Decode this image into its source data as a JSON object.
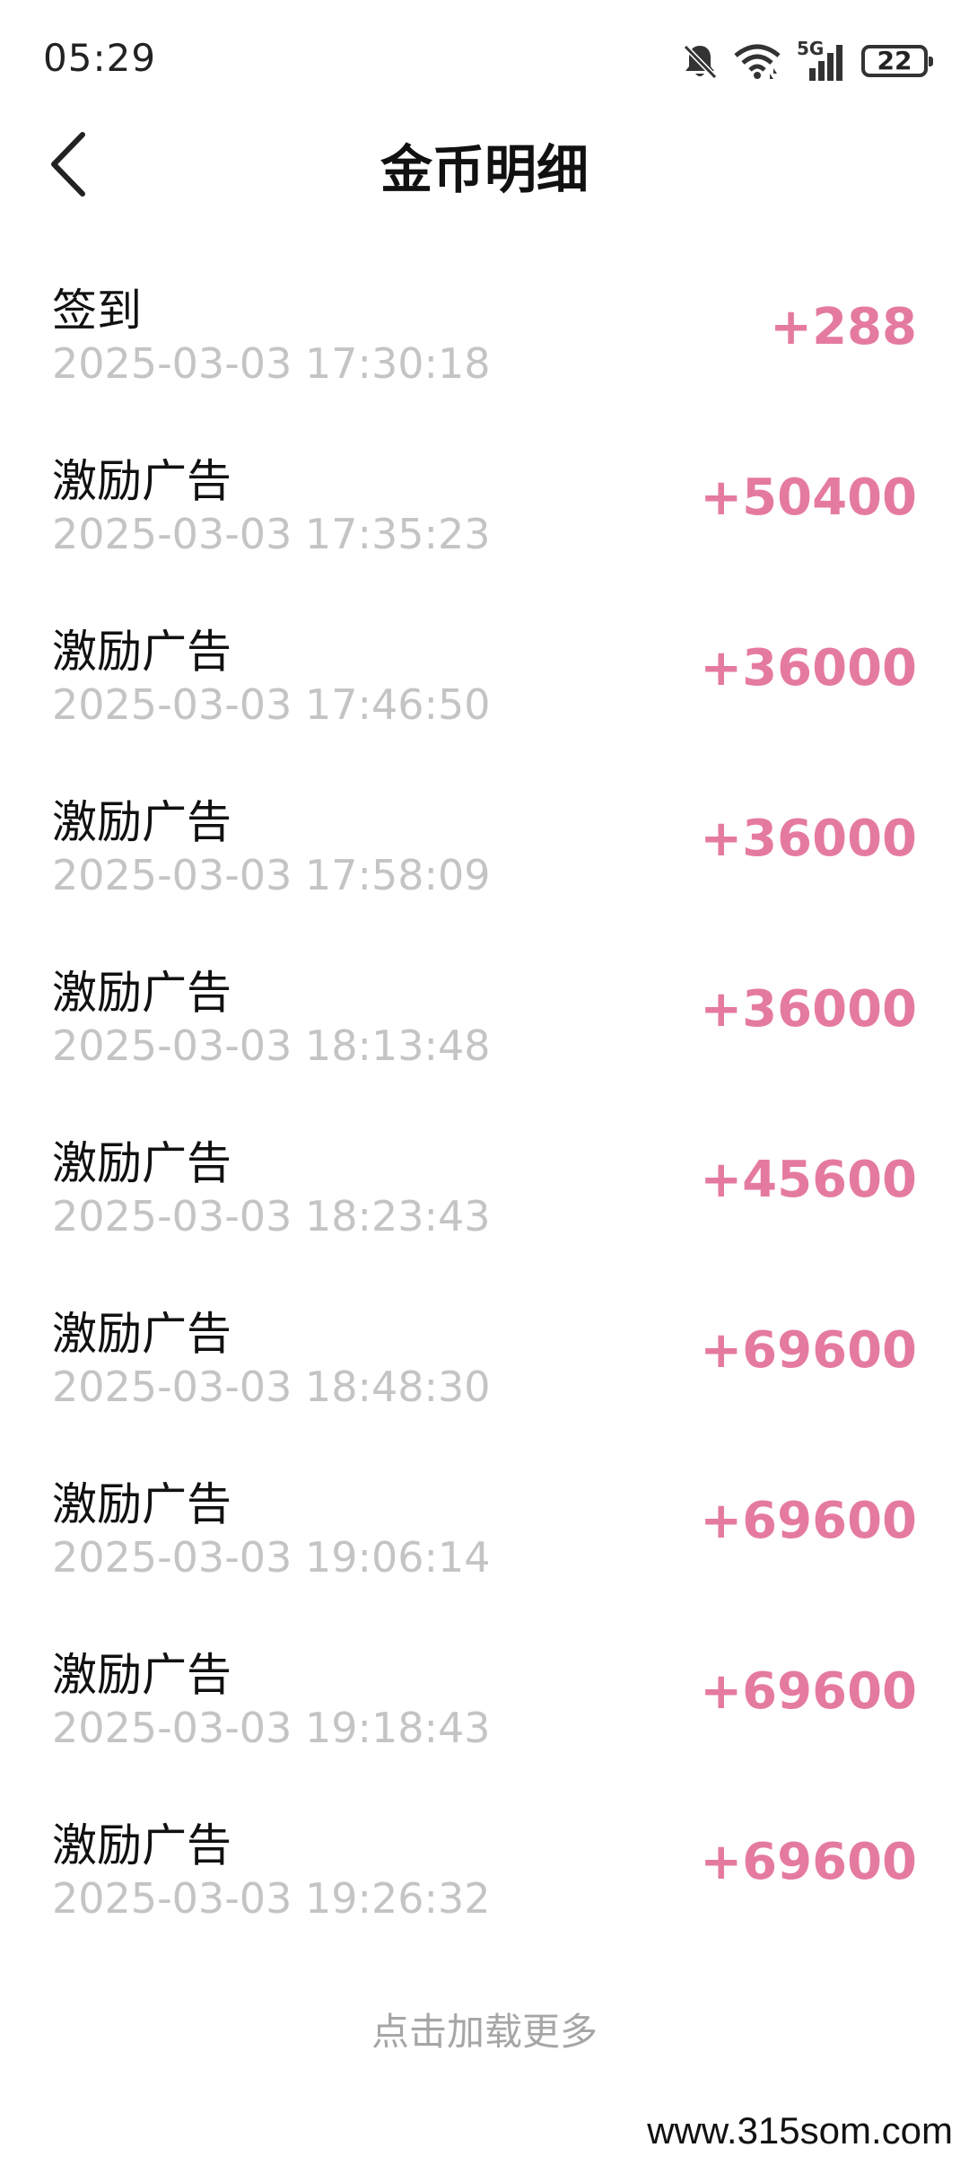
{
  "status_bar": {
    "time": "05:29",
    "network_label": "5G",
    "battery_level": "22",
    "icons": [
      "bell-mute-icon",
      "wifi-icon",
      "cellular-5g-icon",
      "battery-icon"
    ]
  },
  "header": {
    "title": "金币明细",
    "back_icon": "chevron-left-icon"
  },
  "colors": {
    "amount": "#e57aa0",
    "time_text": "#c4c4c4",
    "load_more": "#a6a6a6"
  },
  "records": [
    {
      "label": "签到",
      "time": "2025-03-03 17:30:18",
      "amount": "+288"
    },
    {
      "label": "激励广告",
      "time": "2025-03-03 17:35:23",
      "amount": "+50400"
    },
    {
      "label": "激励广告",
      "time": "2025-03-03 17:46:50",
      "amount": "+36000"
    },
    {
      "label": "激励广告",
      "time": "2025-03-03 17:58:09",
      "amount": "+36000"
    },
    {
      "label": "激励广告",
      "time": "2025-03-03 18:13:48",
      "amount": "+36000"
    },
    {
      "label": "激励广告",
      "time": "2025-03-03 18:23:43",
      "amount": "+45600"
    },
    {
      "label": "激励广告",
      "time": "2025-03-03 18:48:30",
      "amount": "+69600"
    },
    {
      "label": "激励广告",
      "time": "2025-03-03 19:06:14",
      "amount": "+69600"
    },
    {
      "label": "激励广告",
      "time": "2025-03-03 19:18:43",
      "amount": "+69600"
    },
    {
      "label": "激励广告",
      "time": "2025-03-03 19:26:32",
      "amount": "+69600"
    }
  ],
  "load_more": "点击加载更多",
  "watermark": "www.315som.com"
}
